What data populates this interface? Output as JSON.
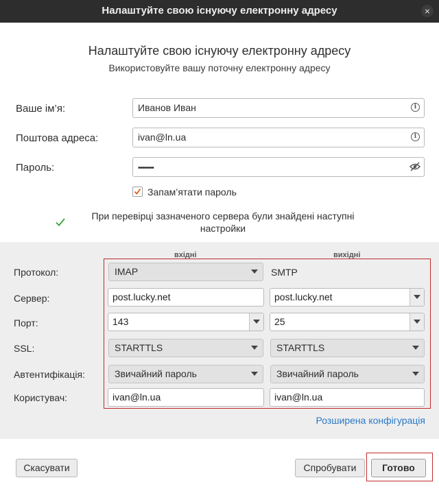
{
  "window": {
    "title": "Налаштуйте свою існуючу електронну адресу",
    "close_glyph": "×"
  },
  "header": {
    "title": "Налаштуйте свою існуючу електронну адресу",
    "subtitle": "Використовуйте вашу поточну електронну адресу"
  },
  "form": {
    "name_label": "Ваше ім’я:",
    "name_value": "Иванов Иван",
    "email_label": "Поштова адреса:",
    "email_value": "ivan@ln.ua",
    "password_label": "Пароль:",
    "password_value": "••••••••",
    "remember_label": "Запам’ятати пароль",
    "remember_checked": true
  },
  "status": {
    "message": "При перевірці зазначеного сервера були знайдені наступні настройки",
    "icon": "checkmark-icon",
    "color": "#3aa43a"
  },
  "server_config": {
    "incoming_header": "вхідні",
    "outgoing_header": "вихідні",
    "rows": {
      "protocol": {
        "label": "Протокол:",
        "incoming": "IMAP",
        "outgoing": "SMTP"
      },
      "server": {
        "label": "Сервер:",
        "incoming": "post.lucky.net",
        "outgoing": "post.lucky.net"
      },
      "port": {
        "label": "Порт:",
        "incoming": "143",
        "outgoing": "25"
      },
      "ssl": {
        "label": "SSL:",
        "incoming": "STARTTLS",
        "outgoing": "STARTTLS"
      },
      "auth": {
        "label": "Автентифікація:",
        "incoming": "Звичайний пароль",
        "outgoing": "Звичайний пароль"
      },
      "user": {
        "label": "Користувач:",
        "incoming": "ivan@ln.ua",
        "outgoing": "ivan@ln.ua"
      }
    },
    "advanced_link": "Розширена конфігурація"
  },
  "buttons": {
    "cancel": "Скасувати",
    "retest": "Спробувати",
    "done": "Готово"
  },
  "colors": {
    "titlebar": "#2d2d2d",
    "link": "#2a78c5",
    "highlight_outline": "#c0292b",
    "checkbox_tick": "#e05a1b"
  }
}
